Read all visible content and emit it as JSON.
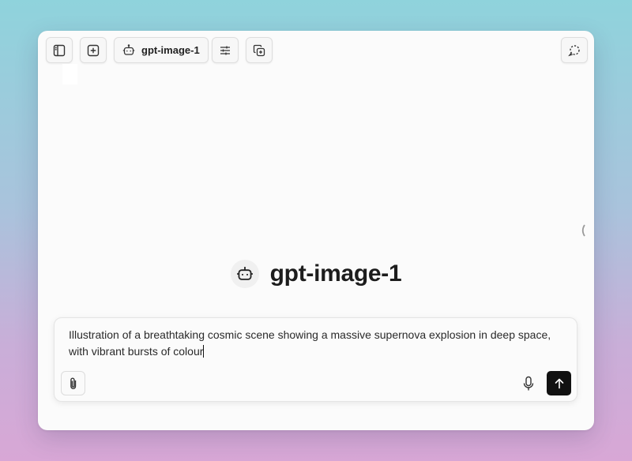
{
  "toolbar": {
    "model_label": "gpt-image-1",
    "icons": [
      "sidebar-icon",
      "new-chat-icon",
      "bot-icon",
      "sliders-icon",
      "copy-icon",
      "dashed-circle-icon"
    ]
  },
  "hero": {
    "title": "gpt-image-1",
    "icon": "bot-icon"
  },
  "composer": {
    "text": "Illustration of a breathtaking cosmic scene showing a massive supernova explosion in deep space, with vibrant bursts of colour",
    "attach_icon": "paperclip-icon",
    "mic_icon": "microphone-icon",
    "send_icon": "arrow-up-icon"
  },
  "colors": {
    "send_button": "#111111",
    "window_bg": "#fbfbfb"
  }
}
